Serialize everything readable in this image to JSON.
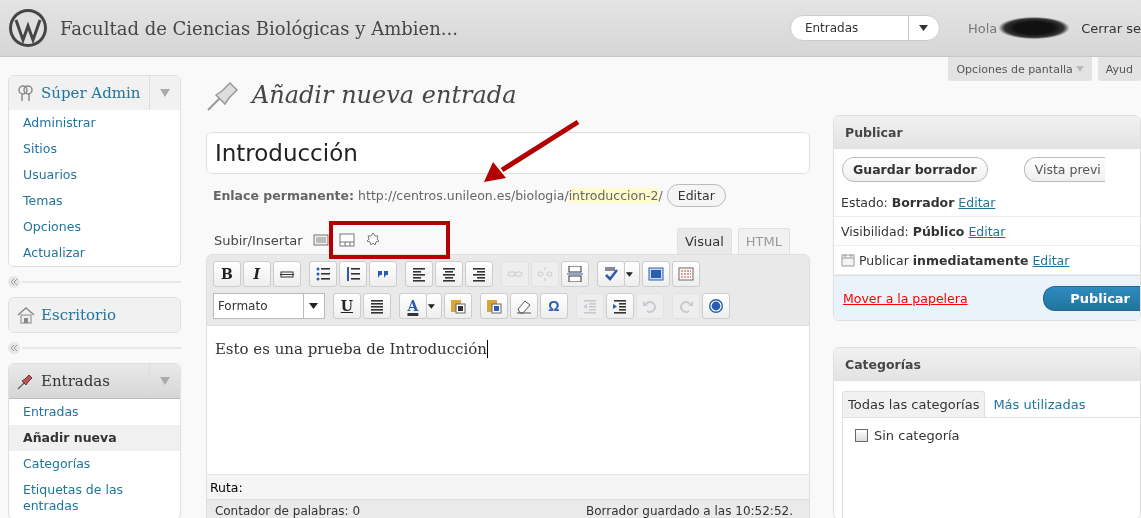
{
  "header": {
    "site_title": "Facultad de Ciencias Biológicas y Ambien...",
    "dropdown": "Entradas",
    "greeting": "Hola",
    "logout": "Cerrar se"
  },
  "screen_tabs": [
    "Opciones de pantalla",
    "Ayud"
  ],
  "sidebar": {
    "menus": [
      {
        "title": "Súper Admin",
        "kind": "admin",
        "current": false,
        "expanded": true,
        "items": [
          {
            "label": "Administrar",
            "selected": false
          },
          {
            "label": "Sitios",
            "selected": false
          },
          {
            "label": "Usuarios",
            "selected": false
          },
          {
            "label": "Temas",
            "selected": false
          },
          {
            "label": "Opciones",
            "selected": false
          },
          {
            "label": "Actualizar",
            "selected": false
          }
        ]
      },
      {
        "title": "Escritorio",
        "kind": "home",
        "current": false,
        "expanded": false
      },
      {
        "title": "Entradas",
        "kind": "pin",
        "current": true,
        "expanded": true,
        "items": [
          {
            "label": "Entradas",
            "selected": false
          },
          {
            "label": "Añadir nueva",
            "selected": true
          },
          {
            "label": "Categorías",
            "selected": false
          },
          {
            "label": "Etiquetas de las entradas",
            "selected": false
          }
        ]
      }
    ]
  },
  "page_title": "Añadir nueva entrada",
  "post_title": "Introducción",
  "permalink": {
    "label": "Enlace permanente:",
    "base": "http://centros.unileon.es/biologia/",
    "slug": "introduccion-2",
    "suffix": "/",
    "button": "Editar"
  },
  "media": {
    "label": "Subir/Insertar"
  },
  "editor_tabs": [
    {
      "label": "Visual",
      "selected": true
    },
    {
      "label": "HTML",
      "selected": false
    }
  ],
  "toolbar": [
    [
      {
        "kind": "bold",
        "label": "B",
        "disabled": false
      },
      {
        "kind": "italic",
        "label": "I",
        "disabled": false
      },
      {
        "kind": "strike",
        "disabled": false
      },
      {
        "kind": "bullist",
        "disabled": false
      },
      {
        "kind": "numlist",
        "disabled": false
      },
      {
        "kind": "quote",
        "disabled": false
      },
      {
        "kind": "alignleft",
        "disabled": false
      },
      {
        "kind": "aligncenter",
        "disabled": false
      },
      {
        "kind": "alignright",
        "disabled": false
      },
      {
        "kind": "link",
        "disabled": true
      },
      {
        "kind": "unlink",
        "disabled": true
      },
      {
        "kind": "more",
        "disabled": false
      },
      {
        "kind": "spell",
        "disabled": false
      },
      {
        "kind": "caret",
        "disabled": false
      },
      {
        "kind": "fullscreen",
        "disabled": false
      },
      {
        "kind": "kitchen",
        "disabled": false
      }
    ],
    [
      {
        "kind": "format",
        "label": "Formato",
        "disabled": false
      },
      {
        "kind": "underline",
        "label": "U",
        "disabled": false
      },
      {
        "kind": "justify",
        "disabled": false
      },
      {
        "kind": "forecolor",
        "label": "A",
        "disabled": false
      },
      {
        "kind": "caret",
        "disabled": false
      },
      {
        "kind": "pastetext",
        "disabled": false
      },
      {
        "kind": "pasteword",
        "disabled": false
      },
      {
        "kind": "eraser",
        "disabled": false
      },
      {
        "kind": "charmap",
        "label": "Ω",
        "disabled": false
      },
      {
        "kind": "outdent",
        "disabled": true
      },
      {
        "kind": "indent",
        "disabled": false
      },
      {
        "kind": "undo",
        "disabled": true
      },
      {
        "kind": "redo",
        "disabled": true
      },
      {
        "kind": "help",
        "disabled": false
      }
    ]
  ],
  "content": "Esto es una prueba de Introducción",
  "path_label": "Ruta:",
  "word_count": "Contador de palabras: 0",
  "autosave": "Borrador guardado a las 10:52:52.",
  "publish": {
    "title": "Publicar",
    "save_button": "Guardar borrador",
    "preview_button": "Vista previ",
    "rows": [
      {
        "kind": "status",
        "label": "Estado:",
        "value": "Borrador",
        "link": "Editar"
      },
      {
        "kind": "visibility",
        "label": "Visibilidad:",
        "value": "Público",
        "link": "Editar"
      },
      {
        "kind": "schedule",
        "label": "Publicar",
        "value": "inmediatamente",
        "link": "Editar"
      }
    ],
    "trash": "Mover a la papelera",
    "publish_button": "Publicar"
  },
  "categories": {
    "title": "Categorías",
    "tabs": [
      {
        "label": "Todas las categorías",
        "selected": true
      },
      {
        "label": "Más utilizadas",
        "selected": false
      }
    ],
    "items": [
      {
        "label": "Sin categoría",
        "checked": false
      }
    ]
  }
}
